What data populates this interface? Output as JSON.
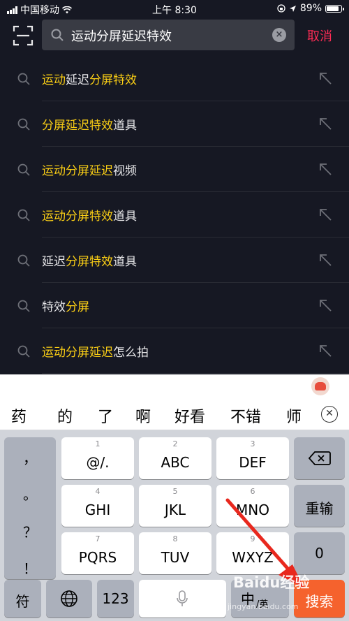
{
  "status_bar": {
    "carrier": "中国移动",
    "time": "上午 8:30",
    "battery_text": "89%",
    "battery_level": 0.89
  },
  "search": {
    "query": "运动分屏延迟特效",
    "cancel_label": "取消"
  },
  "suggestions": [
    {
      "parts": [
        {
          "text": "运动",
          "hl": true
        },
        {
          "text": "延迟",
          "hl": false
        },
        {
          "text": "分屏特效",
          "hl": true
        }
      ]
    },
    {
      "parts": [
        {
          "text": "分屏延迟特效",
          "hl": true
        },
        {
          "text": "道具",
          "hl": false
        }
      ]
    },
    {
      "parts": [
        {
          "text": "运动分屏延迟",
          "hl": true
        },
        {
          "text": "视频",
          "hl": false
        }
      ]
    },
    {
      "parts": [
        {
          "text": "运动分屏特效",
          "hl": true
        },
        {
          "text": "道具",
          "hl": false
        }
      ]
    },
    {
      "parts": [
        {
          "text": "延迟",
          "hl": false
        },
        {
          "text": "分屏特效",
          "hl": true
        },
        {
          "text": "道具",
          "hl": false
        }
      ]
    },
    {
      "parts": [
        {
          "text": "特效",
          "hl": false
        },
        {
          "text": "分屏",
          "hl": true
        }
      ]
    },
    {
      "parts": [
        {
          "text": "运动分屏延迟",
          "hl": true
        },
        {
          "text": "怎么拍",
          "hl": false
        }
      ]
    }
  ],
  "keyboard": {
    "candidates": [
      "药",
      "的",
      "了",
      "啊",
      "好看",
      "不错",
      "师"
    ],
    "left_column": [
      "，",
      "。",
      "？",
      "！"
    ],
    "rows": [
      [
        {
          "sub": "1",
          "main": "@/."
        },
        {
          "sub": "2",
          "main": "ABC"
        },
        {
          "sub": "3",
          "main": "DEF"
        }
      ],
      [
        {
          "sub": "4",
          "main": "GHI"
        },
        {
          "sub": "5",
          "main": "JKL"
        },
        {
          "sub": "6",
          "main": "MNO"
        }
      ],
      [
        {
          "sub": "7",
          "main": "PQRS"
        },
        {
          "sub": "8",
          "main": "TUV"
        },
        {
          "sub": "9",
          "main": "WXYZ"
        }
      ]
    ],
    "retype_label": "重输",
    "zero_label": "0",
    "symbol_label": "符",
    "number_label": "123",
    "chinese_label": "中",
    "chinese_sub": "/英",
    "search_label": "搜索"
  },
  "watermark": {
    "brand": "Baidu经验",
    "url": "jingyan.baidu.com"
  },
  "colors": {
    "background": "#161823",
    "highlight": "#face15",
    "cancel": "#fe2c55",
    "search_key": "#f5622d",
    "annotation_arrow": "#e8281e"
  }
}
